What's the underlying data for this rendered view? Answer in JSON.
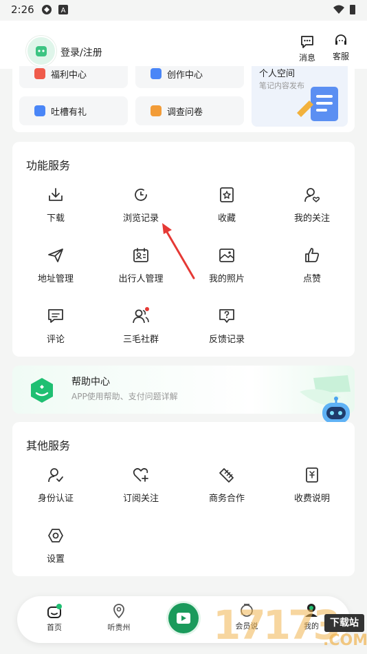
{
  "status": {
    "time": "2:26"
  },
  "header": {
    "login_label": "登录/注册",
    "messages_label": "消息",
    "service_label": "客服"
  },
  "top_card": {
    "items": [
      {
        "label": "福利中心",
        "icon": "gift-icon",
        "color": "#ef5b4b"
      },
      {
        "label": "创作中心",
        "icon": "create-icon",
        "color": "#4a86f7"
      },
      {
        "label": "吐槽有礼",
        "icon": "edit-icon",
        "color": "#4a86f7"
      },
      {
        "label": "调查问卷",
        "icon": "survey-icon",
        "color": "#f29c38"
      }
    ],
    "space": {
      "title": "个人空间",
      "subtitle": "笔记内容发布"
    }
  },
  "function_services": {
    "title": "功能服务",
    "items": [
      {
        "label": "下载",
        "icon": "download-icon"
      },
      {
        "label": "浏览记录",
        "icon": "history-icon"
      },
      {
        "label": "收藏",
        "icon": "favorite-icon"
      },
      {
        "label": "我的关注",
        "icon": "follow-icon"
      },
      {
        "label": "地址管理",
        "icon": "send-icon"
      },
      {
        "label": "出行人管理",
        "icon": "traveler-icon"
      },
      {
        "label": "我的照片",
        "icon": "photo-icon"
      },
      {
        "label": "点赞",
        "icon": "like-icon"
      },
      {
        "label": "评论",
        "icon": "comment-icon"
      },
      {
        "label": "三毛社群",
        "icon": "community-icon"
      },
      {
        "label": "反馈记录",
        "icon": "feedback-icon"
      }
    ]
  },
  "help_center": {
    "title": "帮助中心",
    "subtitle": "APP使用帮助、支付问题详解"
  },
  "other_services": {
    "title": "其他服务",
    "items": [
      {
        "label": "身份认证",
        "icon": "identity-icon"
      },
      {
        "label": "订阅关注",
        "icon": "subscribe-icon"
      },
      {
        "label": "商务合作",
        "icon": "handshake-icon"
      },
      {
        "label": "收费说明",
        "icon": "fee-icon"
      },
      {
        "label": "设置",
        "icon": "settings-icon"
      }
    ]
  },
  "bottom_nav": {
    "items": [
      {
        "label": "首页",
        "icon": "home-icon"
      },
      {
        "label": "听贵州",
        "icon": "location-icon"
      },
      {
        "label": "",
        "icon": "video-icon"
      },
      {
        "label": "会员说",
        "icon": "member-icon"
      },
      {
        "label": "我的",
        "icon": "profile-icon"
      }
    ]
  },
  "watermark": {
    "number": "17173",
    "site": "下载站",
    "dotcom": ".COM"
  },
  "colors": {
    "accent": "#1fbf72",
    "red": "#e53935",
    "icon": "#333333"
  }
}
